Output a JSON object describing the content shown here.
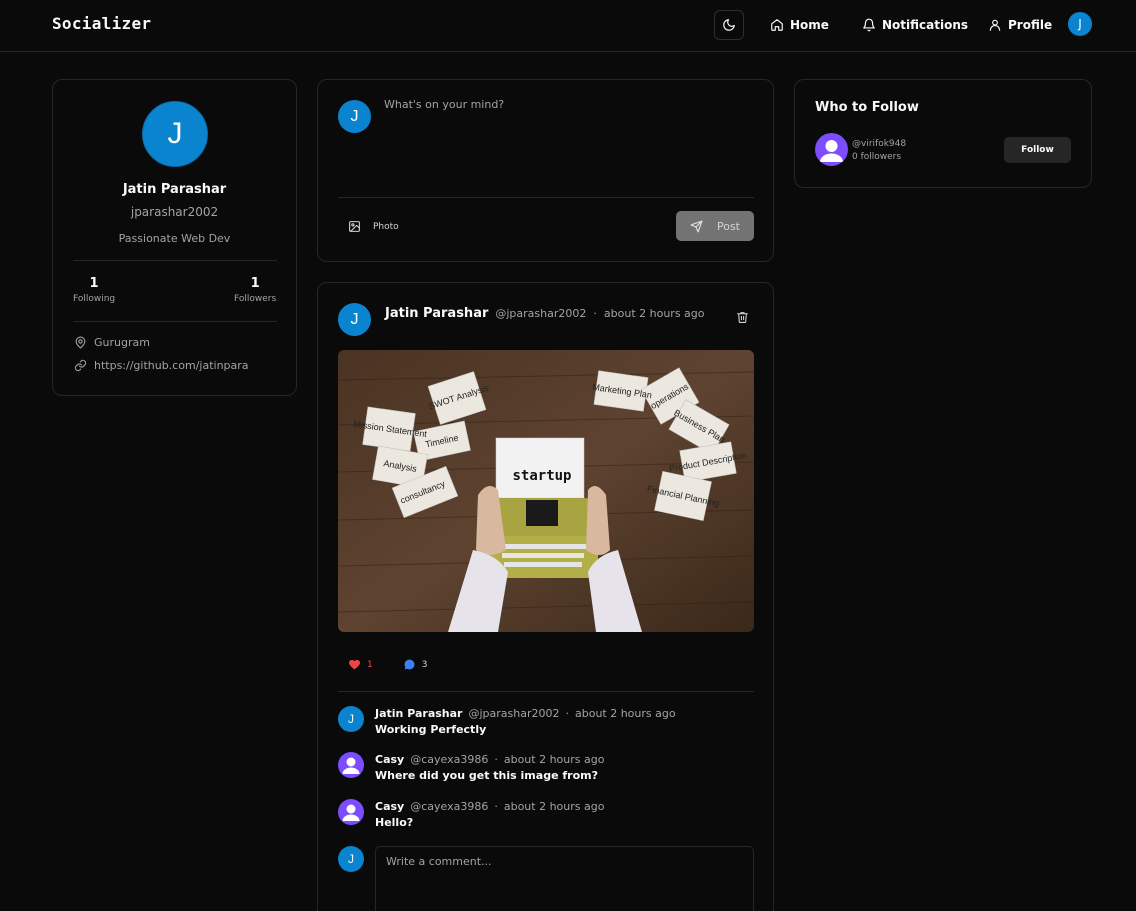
{
  "nav": {
    "brand": "Socializer",
    "home_label": "Home",
    "notifications_label": "Notifications",
    "profile_label": "Profile",
    "avatar_initial": "J"
  },
  "profile": {
    "initial": "J",
    "name": "Jatin Parashar",
    "handle": "jparashar2002",
    "bio": "Passionate Web Dev",
    "following_count": "1",
    "following_label": "Following",
    "followers_count": "1",
    "followers_label": "Followers",
    "location": "Gurugram",
    "website": "https://github.com/jatinpara"
  },
  "compose": {
    "initial": "J",
    "placeholder": "What's on your mind?",
    "photo_label": "Photo",
    "post_label": "Post"
  },
  "post": {
    "initial": "J",
    "author": "Jatin Parashar",
    "handle": "@jparashar2002",
    "separator": "·",
    "time": "about 2 hours ago",
    "image_alt": "startup",
    "image_notes": [
      "SWOT Analysis",
      "Mission Statement",
      "Timeline",
      "Analysis",
      "consultancy",
      "Marketing Plan",
      "operations",
      "Business Plan",
      "Product Description",
      "Financial Planning"
    ],
    "likes": "1",
    "comments_count": "3",
    "comments": [
      {
        "initial": "J",
        "avatar": "blue",
        "author": "Jatin Parashar",
        "handle": "@jparashar2002",
        "time": "about 2 hours ago",
        "text": "Working Perfectly"
      },
      {
        "initial": "",
        "avatar": "purple",
        "author": "Casy",
        "handle": "@cayexa3986",
        "time": "about 2 hours ago",
        "text": "Where did you get this image from?"
      },
      {
        "initial": "",
        "avatar": "purple",
        "author": "Casy",
        "handle": "@cayexa3986",
        "time": "about 2 hours ago",
        "text": "Hello?"
      }
    ],
    "reply_initial": "J",
    "reply_placeholder": "Write a comment..."
  },
  "who_to_follow": {
    "title": "Who to Follow",
    "users": [
      {
        "handle": "@virifok948",
        "followers": "0 followers",
        "button": "Follow"
      }
    ]
  },
  "colors": {
    "background": "#0a0a0a",
    "border": "#262626",
    "accent_blue": "#0b84d0",
    "accent_purple": "#7c4dff",
    "like_red": "#ef4444",
    "comment_blue": "#3b82f6"
  }
}
